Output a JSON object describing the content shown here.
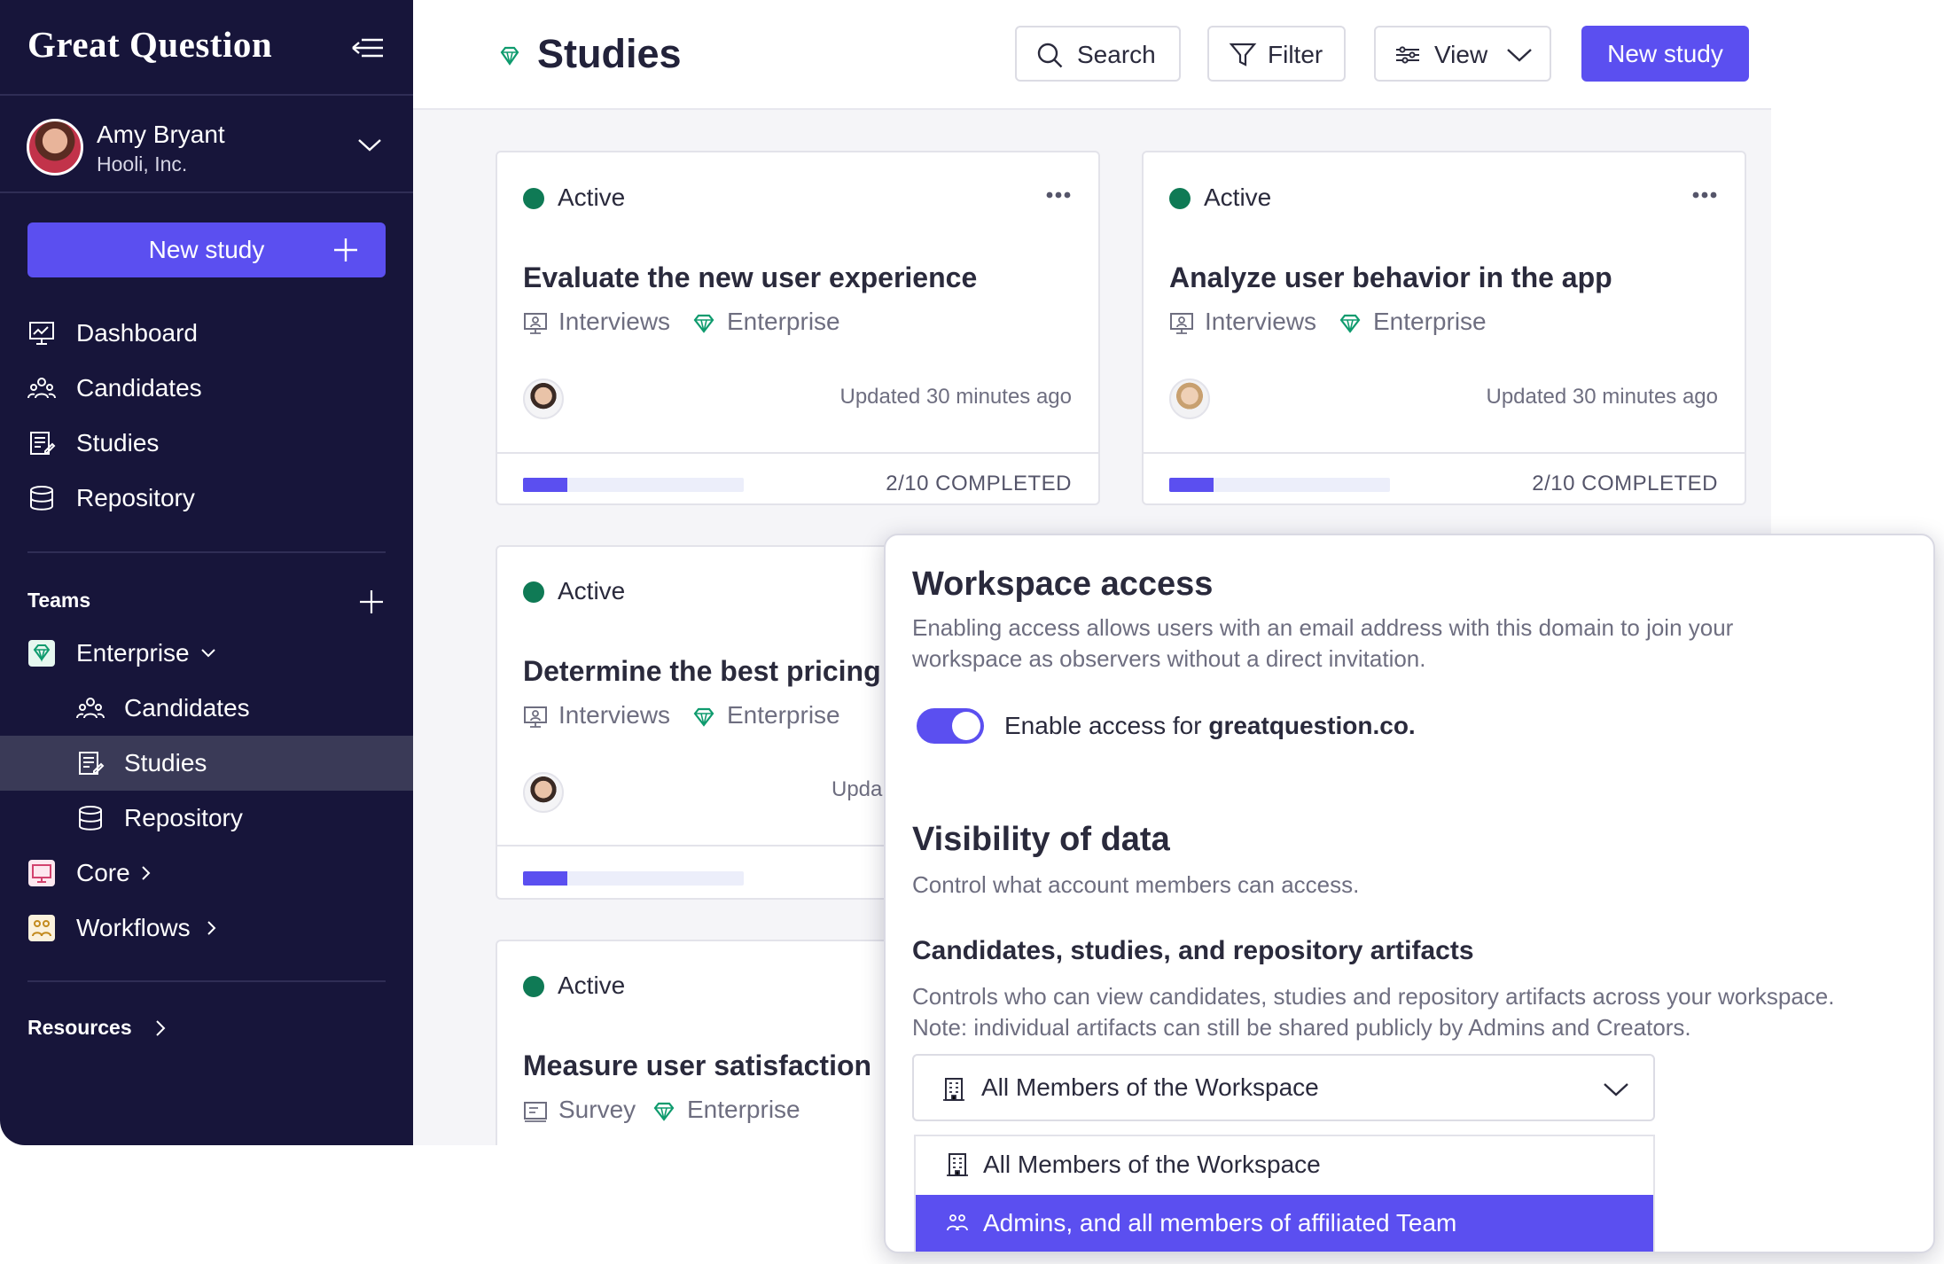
{
  "app": {
    "brand": "Great Question"
  },
  "user": {
    "name": "Amy Bryant",
    "org": "Hooli, Inc."
  },
  "sidebar": {
    "new_study_label": "New study",
    "nav": [
      {
        "label": "Dashboard",
        "icon": "dashboard-icon"
      },
      {
        "label": "Candidates",
        "icon": "candidates-icon"
      },
      {
        "label": "Studies",
        "icon": "studies-icon"
      },
      {
        "label": "Repository",
        "icon": "repository-icon"
      }
    ],
    "teams_heading": "Teams",
    "teams": [
      {
        "label": "Enterprise",
        "icon": "diamond-icon",
        "expanded": true
      },
      {
        "label": "Candidates",
        "icon": "candidates-icon"
      },
      {
        "label": "Studies",
        "icon": "studies-icon",
        "active": true
      },
      {
        "label": "Repository",
        "icon": "repository-icon"
      },
      {
        "label": "Core",
        "icon": "monitor-icon"
      },
      {
        "label": "Workflows",
        "icon": "workflow-icon"
      }
    ],
    "resources_label": "Resources"
  },
  "header": {
    "title": "Studies",
    "search_label": "Search",
    "filter_label": "Filter",
    "view_label": "View",
    "new_study_label": "New study"
  },
  "studies": [
    {
      "status": "Active",
      "title": "Evaluate the new user experience",
      "method": "Interviews",
      "team": "Enterprise",
      "updated": "Updated 30 minutes ago",
      "progress": 0.2,
      "completed": "2/10 COMPLETED"
    },
    {
      "status": "Active",
      "title": "Analyze user behavior in the app",
      "method": "Interviews",
      "team": "Enterprise",
      "updated": "Updated 30 minutes ago",
      "progress": 0.2,
      "completed": "2/10 COMPLETED"
    },
    {
      "status": "Active",
      "title": "Determine the best pricing",
      "method": "Interviews",
      "team": "Enterprise",
      "updated": "Upda",
      "progress": 0.2
    },
    {
      "status": "Active",
      "title": "Measure user satisfaction",
      "method": "Survey",
      "team": "Enterprise"
    }
  ],
  "settings": {
    "workspace_access": {
      "title": "Workspace access",
      "description_line1": "Enabling access allows users with an email address with this domain to join your",
      "description_line2": "workspace as observers without a direct invitation.",
      "toggle_prefix": "Enable access for ",
      "toggle_domain": "greatquestion.co.",
      "enabled": true
    },
    "visibility": {
      "title": "Visibility of data",
      "description": "Control what account members can access.",
      "subtitle": "Candidates, studies, and repository artifacts",
      "sub_description_line1": "Controls who can view candidates, studies and repository artifacts across your workspace.",
      "sub_description_line2": "Note: individual artifacts can still be shared publicly by Admins and Creators.",
      "selected": "All Members of the Workspace",
      "options": [
        {
          "label": "All Members of the Workspace",
          "icon": "building-icon"
        },
        {
          "label": "Admins, and all members of affiliated Team",
          "icon": "team-icon",
          "highlighted": true
        }
      ]
    }
  },
  "colors": {
    "sidebar_bg": "#17153a",
    "accent": "#5b4ff0",
    "status_active": "#0f7a55",
    "team_green": "#0f9b6e"
  }
}
